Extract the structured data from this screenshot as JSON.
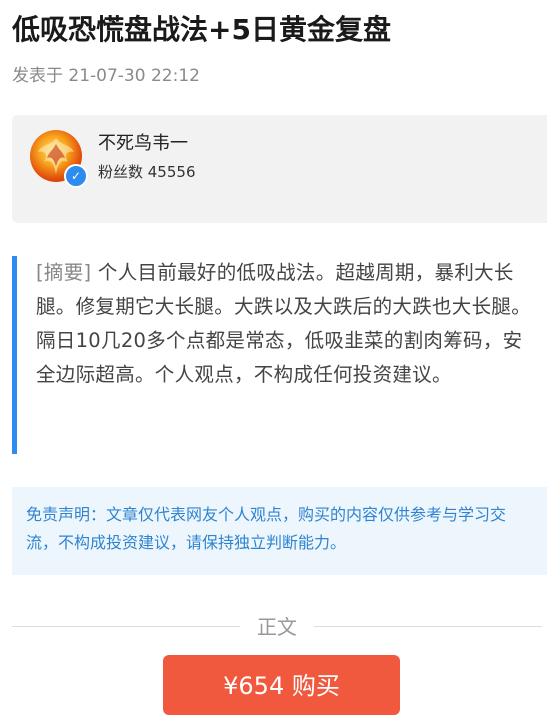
{
  "article": {
    "title": "低吸恐慌盘战法+5日黄金复盘",
    "published": "发表于 21-07-30 22:12"
  },
  "author": {
    "name": "不死鸟韦一",
    "followers": "粉丝数 45556",
    "verified_icon": "verified-check-icon",
    "verified_mark": "✓"
  },
  "summary": {
    "tag": "[摘要]",
    "text": " 个人目前最好的低吸战法。超越周期，暴利大长腿。修复期它大长腿。大跌以及大跌后的大跌也大长腿。隔日10几20多个点都是常态，低吸韭菜的割肉筹码，安全边际超高。个人观点，不构成任何投资建议。"
  },
  "disclaimer": {
    "text": "免责声明：文章仅代表网友个人观点，购买的内容仅供参考与学习交流，不构成投资建议，请保持独立判断能力。"
  },
  "divider": {
    "label": "正文"
  },
  "purchase": {
    "label": "¥654 购买"
  },
  "colors": {
    "accent_blue": "#2d8cf0",
    "buy_red": "#f0593e",
    "disclaimer_bg": "#eef6fd",
    "disclaimer_text": "#2f84d0",
    "card_bg": "#f2f2f2"
  }
}
